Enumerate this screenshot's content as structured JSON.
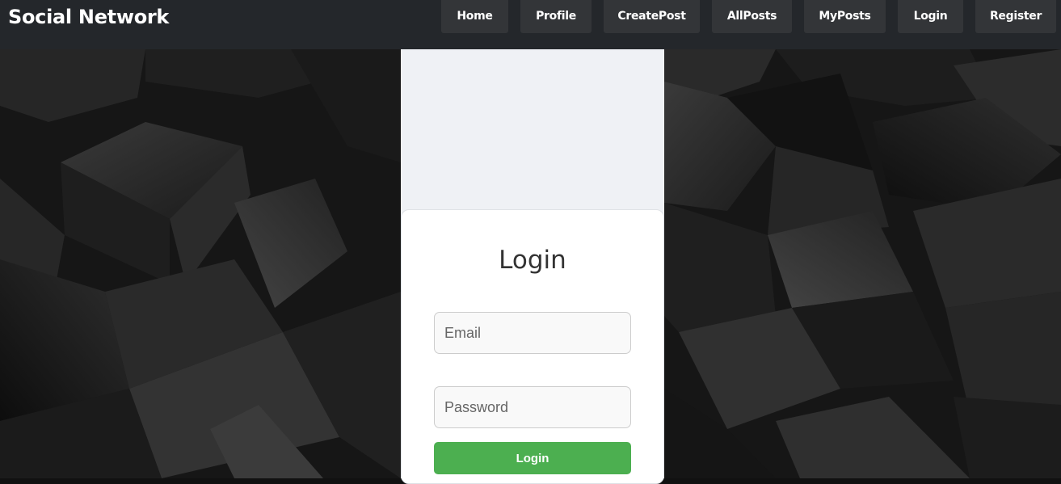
{
  "navbar": {
    "brand": "Social Network",
    "items": [
      {
        "label": "Home"
      },
      {
        "label": "Profile"
      },
      {
        "label": "CreatePost"
      },
      {
        "label": "AllPosts"
      },
      {
        "label": "MyPosts"
      },
      {
        "label": "Login"
      },
      {
        "label": "Register"
      }
    ]
  },
  "login_form": {
    "title": "Login",
    "email_placeholder": "Email",
    "email_value": "",
    "password_placeholder": "Password",
    "password_value": "",
    "submit_label": "Login"
  },
  "colors": {
    "navbar_bg": "#24272b",
    "nav_button_bg": "#333538",
    "panel_bg": "#eff1f5",
    "submit_bg": "#4caf50",
    "background": "#141414"
  }
}
